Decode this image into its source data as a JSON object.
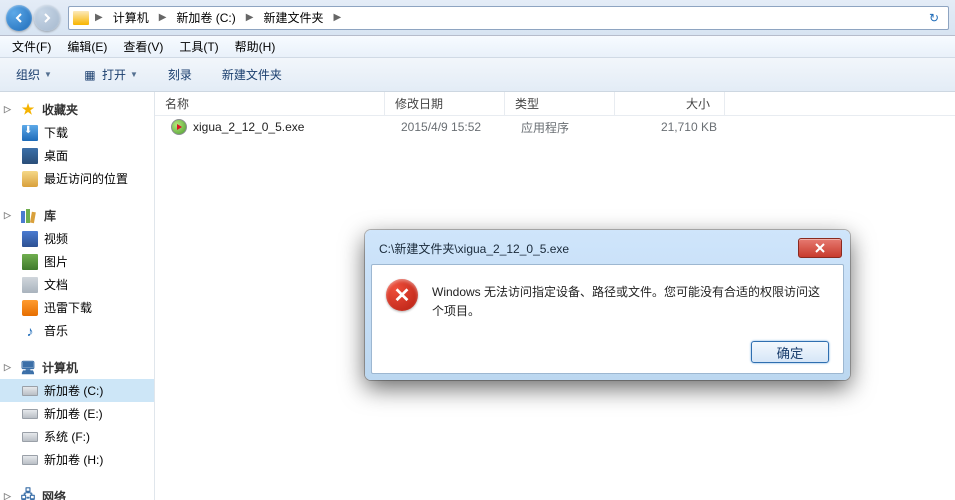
{
  "breadcrumbs": [
    "计算机",
    "新加卷 (C:)",
    "新建文件夹"
  ],
  "menubar": {
    "file": "文件(F)",
    "edit": "编辑(E)",
    "view": "查看(V)",
    "tools": "工具(T)",
    "help": "帮助(H)"
  },
  "toolbar": {
    "organize": "组织",
    "open": "打开",
    "burn": "刻录",
    "newfolder": "新建文件夹"
  },
  "sidebar": {
    "favorites": {
      "header": "收藏夹",
      "items": [
        "下载",
        "桌面",
        "最近访问的位置"
      ]
    },
    "libraries": {
      "header": "库",
      "items": [
        "视频",
        "图片",
        "文档",
        "迅雷下载",
        "音乐"
      ]
    },
    "computer": {
      "header": "计算机",
      "items": [
        "新加卷 (C:)",
        "新加卷 (E:)",
        "系统 (F:)",
        "新加卷 (H:)"
      ]
    },
    "network": {
      "header": "网络"
    }
  },
  "columns": {
    "name": "名称",
    "date": "修改日期",
    "type": "类型",
    "size": "大小"
  },
  "files": [
    {
      "name": "xigua_2_12_0_5.exe",
      "date": "2015/4/9 15:52",
      "type": "应用程序",
      "size": "21,710 KB"
    }
  ],
  "dialog": {
    "title": "C:\\新建文件夹\\xigua_2_12_0_5.exe",
    "message": "Windows 无法访问指定设备、路径或文件。您可能没有合适的权限访问这个项目。",
    "ok": "确定"
  }
}
